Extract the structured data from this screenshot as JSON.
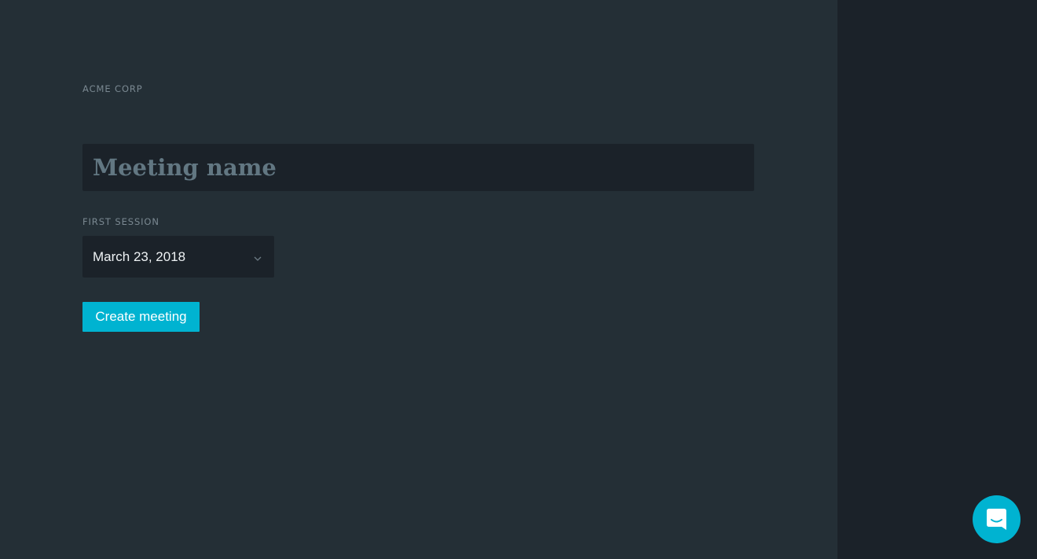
{
  "organization": {
    "name": "ACME CORP"
  },
  "form": {
    "meeting_name_placeholder": "Meeting name",
    "meeting_name_value": "",
    "first_session_label": "FIRST SESSION",
    "first_session_value": "March 23, 2018",
    "submit_label": "Create meeting"
  },
  "icons": {
    "dropdown": "chevron-down-icon",
    "chat": "chat-icon"
  },
  "colors": {
    "accent": "#00b3d1",
    "background": "#242f36",
    "sidebar": "#1b2229"
  }
}
